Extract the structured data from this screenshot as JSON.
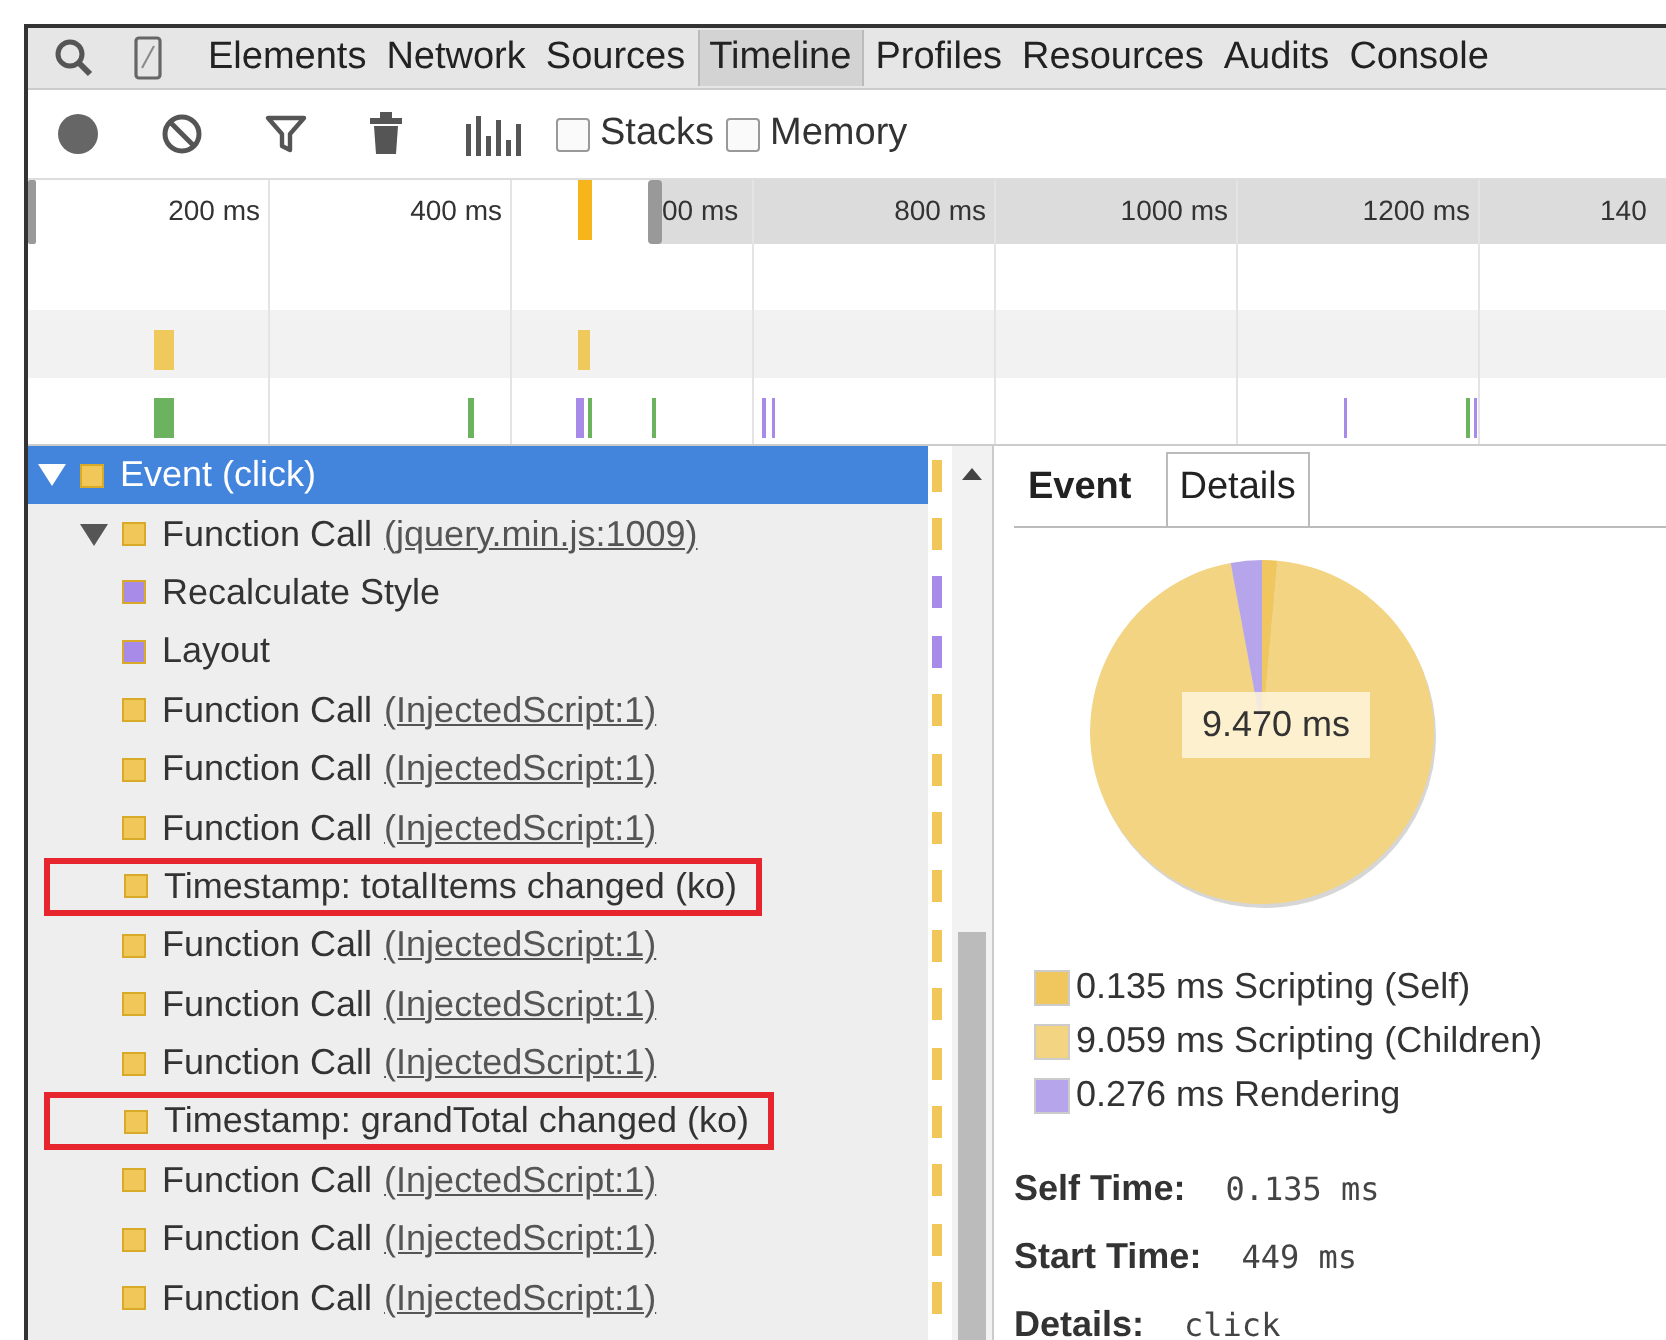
{
  "panel_tabs": [
    {
      "label": "Elements",
      "selected": false
    },
    {
      "label": "Network",
      "selected": false
    },
    {
      "label": "Sources",
      "selected": false
    },
    {
      "label": "Timeline",
      "selected": true
    },
    {
      "label": "Profiles",
      "selected": false
    },
    {
      "label": "Resources",
      "selected": false
    },
    {
      "label": "Audits",
      "selected": false
    },
    {
      "label": "Console",
      "selected": false
    }
  ],
  "toolbar": {
    "checkboxes": [
      {
        "label": "Stacks",
        "checked": false
      },
      {
        "label": "Memory",
        "checked": false
      }
    ]
  },
  "overview": {
    "ticks": [
      "200 ms",
      "400 ms",
      "00 ms",
      "800 ms",
      "1000 ms",
      "1200 ms",
      "140"
    ]
  },
  "tree": [
    {
      "label": "Event (click)",
      "color": "#f2c75a",
      "expanded": true,
      "selected": true,
      "highlighted": false,
      "children": [
        {
          "label": "Function Call",
          "link": "(jquery.min.js:1009)",
          "color": "#f2c75a",
          "expanded": true,
          "selected": false,
          "highlighted": false,
          "children": [
            {
              "label": "Recalculate Style",
              "color": "#a88ae8",
              "selected": false,
              "highlighted": false
            },
            {
              "label": "Layout",
              "color": "#a88ae8",
              "selected": false,
              "highlighted": false
            },
            {
              "label": "Function Call",
              "link": "(InjectedScript:1)",
              "color": "#f2c75a",
              "selected": false,
              "highlighted": false
            },
            {
              "label": "Function Call",
              "link": "(InjectedScript:1)",
              "color": "#f2c75a",
              "selected": false,
              "highlighted": false
            },
            {
              "label": "Function Call",
              "link": "(InjectedScript:1)",
              "color": "#f2c75a",
              "selected": false,
              "highlighted": false
            },
            {
              "label": "Timestamp: totalItems changed (ko)",
              "color": "#f2c75a",
              "selected": false,
              "highlighted": true
            },
            {
              "label": "Function Call",
              "link": "(InjectedScript:1)",
              "color": "#f2c75a",
              "selected": false,
              "highlighted": false
            },
            {
              "label": "Function Call",
              "link": "(InjectedScript:1)",
              "color": "#f2c75a",
              "selected": false,
              "highlighted": false
            },
            {
              "label": "Function Call",
              "link": "(InjectedScript:1)",
              "color": "#f2c75a",
              "selected": false,
              "highlighted": false
            },
            {
              "label": "Timestamp: grandTotal changed (ko)",
              "color": "#f2c75a",
              "selected": false,
              "highlighted": true
            },
            {
              "label": "Function Call",
              "link": "(InjectedScript:1)",
              "color": "#f2c75a",
              "selected": false,
              "highlighted": false
            },
            {
              "label": "Function Call",
              "link": "(InjectedScript:1)",
              "color": "#f2c75a",
              "selected": false,
              "highlighted": false
            },
            {
              "label": "Function Call",
              "link": "(InjectedScript:1)",
              "color": "#f2c75a",
              "selected": false,
              "highlighted": false
            }
          ]
        }
      ]
    }
  ],
  "details_tabs": [
    {
      "label": "Event",
      "selected": true
    },
    {
      "label": "Details",
      "selected": false
    }
  ],
  "summary": {
    "total_label": "9.470 ms",
    "legend": [
      {
        "label": "0.135 ms Scripting (Self)",
        "color": "#efc75e"
      },
      {
        "label": "9.059 ms Scripting (Children)",
        "color": "#f2d483"
      },
      {
        "label": "0.276 ms Rendering",
        "color": "#b7a5ec"
      }
    ]
  },
  "fields": [
    {
      "label": "Self Time:",
      "value": "0.135 ms"
    },
    {
      "label": "Start Time:",
      "value": "449 ms"
    },
    {
      "label": "Details:",
      "value": "click"
    }
  ]
}
